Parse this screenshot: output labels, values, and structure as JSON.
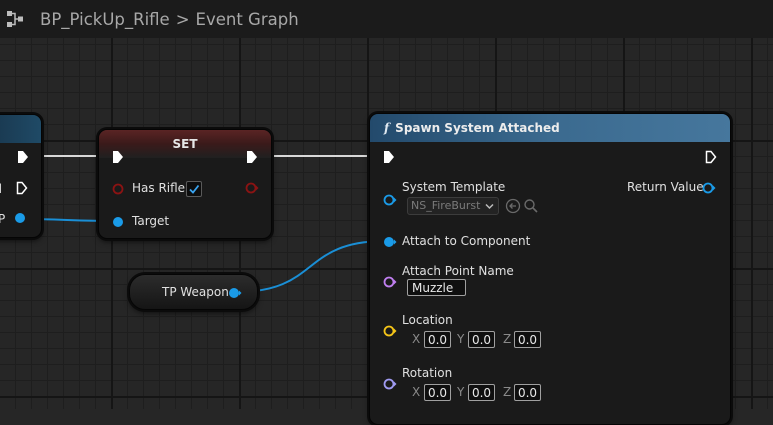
{
  "header": {
    "blueprint_name": "BP_PickUp_Rifle",
    "separator": ">",
    "graph_name": "Event Graph"
  },
  "nodes": {
    "left_node": {
      "output_label_partial": "ed",
      "target_label_partial": "P"
    },
    "set_node": {
      "title": "SET",
      "has_rifle_label": "Has Rifle",
      "has_rifle_checked": true,
      "target_label": "Target"
    },
    "variable_node": {
      "label": "TP Weapon"
    },
    "spawn_node": {
      "function_glyph": "f",
      "title": "Spawn System Attached",
      "system_template_label": "System Template",
      "system_template_value": "NS_FireBurst",
      "return_value_label": "Return Value",
      "attach_component_label": "Attach to Component",
      "attach_point_label": "Attach Point Name",
      "attach_point_value": "Muzzle",
      "location_label": "Location",
      "location": {
        "x_label": "X",
        "x": "0.0",
        "y_label": "Y",
        "y": "0.0",
        "z_label": "Z",
        "z": "0.0"
      },
      "rotation_label": "Rotation",
      "rotation": {
        "x_label": "X",
        "x": "0.0",
        "y_label": "Y",
        "y": "0.0",
        "z_label": "Z",
        "z": "0.0"
      }
    }
  },
  "colors": {
    "exec_pin": "#ffffff",
    "object_pin": "#1a9be8",
    "bool_pin": "#8b1313",
    "name_pin": "#c07ff0",
    "vector_pin": "#f5c518",
    "rotator_pin": "#a09bf2",
    "wire_object": "#1a8fd6"
  }
}
